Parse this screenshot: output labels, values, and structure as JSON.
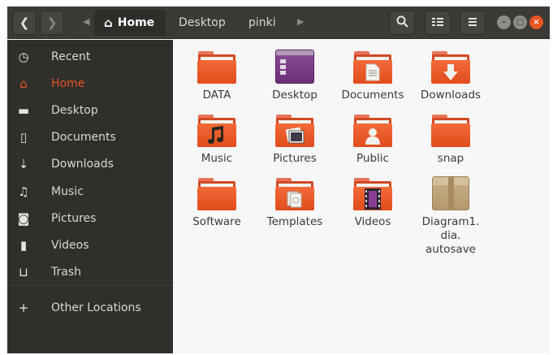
{
  "header": {
    "back_icon": "chevron-left-icon",
    "back_glyph": "❮",
    "forward_icon": "chevron-right-icon",
    "forward_glyph": "❯",
    "path_left_glyph": "◀",
    "path_right_glyph": "▶",
    "home_glyph": "⌂",
    "path": [
      {
        "label": "Home",
        "active": true
      },
      {
        "label": "Desktop",
        "active": false
      },
      {
        "label": "pinki",
        "active": false
      }
    ],
    "search_icon": "search-icon",
    "search_glyph": "🔍",
    "view_icon": "list-view-icon",
    "view_glyph": "☷",
    "menu_icon": "hamburger-menu-icon",
    "menu_glyph": "≡",
    "min_glyph": "–",
    "max_glyph": "□",
    "close_glyph": "×"
  },
  "sidebar": {
    "items": [
      {
        "label": "Recent",
        "icon": "clock-icon",
        "glyph": "◷"
      },
      {
        "label": "Home",
        "icon": "home-icon",
        "glyph": "⌂",
        "active": true
      },
      {
        "label": "Desktop",
        "icon": "desktop-folder-icon",
        "glyph": "▬"
      },
      {
        "label": "Documents",
        "icon": "document-icon",
        "glyph": "▯"
      },
      {
        "label": "Downloads",
        "icon": "download-icon",
        "glyph": "⇣"
      },
      {
        "label": "Music",
        "icon": "music-icon",
        "glyph": "♫"
      },
      {
        "label": "Pictures",
        "icon": "camera-icon",
        "glyph": "◙"
      },
      {
        "label": "Videos",
        "icon": "video-icon",
        "glyph": "▮"
      },
      {
        "label": "Trash",
        "icon": "trash-icon",
        "glyph": "⊔"
      },
      {
        "label": "Other Locations",
        "icon": "plus-icon",
        "glyph": "+"
      }
    ]
  },
  "files": [
    {
      "label": "DATA",
      "type": "folder",
      "emblem": ""
    },
    {
      "label": "Desktop",
      "type": "desktop",
      "emblem": ""
    },
    {
      "label": "Documents",
      "type": "folder",
      "emblem": "document"
    },
    {
      "label": "Downloads",
      "type": "folder",
      "emblem": "download"
    },
    {
      "label": "Music",
      "type": "folder",
      "emblem": "music"
    },
    {
      "label": "Pictures",
      "type": "folder",
      "emblem": "pictures"
    },
    {
      "label": "Public",
      "type": "folder",
      "emblem": "person"
    },
    {
      "label": "snap",
      "type": "folder",
      "emblem": ""
    },
    {
      "label": "Software",
      "type": "folder",
      "emblem": ""
    },
    {
      "label": "Templates",
      "type": "folder",
      "emblem": "templates"
    },
    {
      "label": "Videos",
      "type": "folder",
      "emblem": "video"
    },
    {
      "label": "Diagram1.\ndia.\nautosave",
      "type": "file",
      "emblem": "package"
    }
  ],
  "colors": {
    "accent": "#e95420",
    "sidebar_bg": "#302f2c",
    "header_bg": "#3b3a37",
    "content_bg": "#f7f7f7"
  }
}
